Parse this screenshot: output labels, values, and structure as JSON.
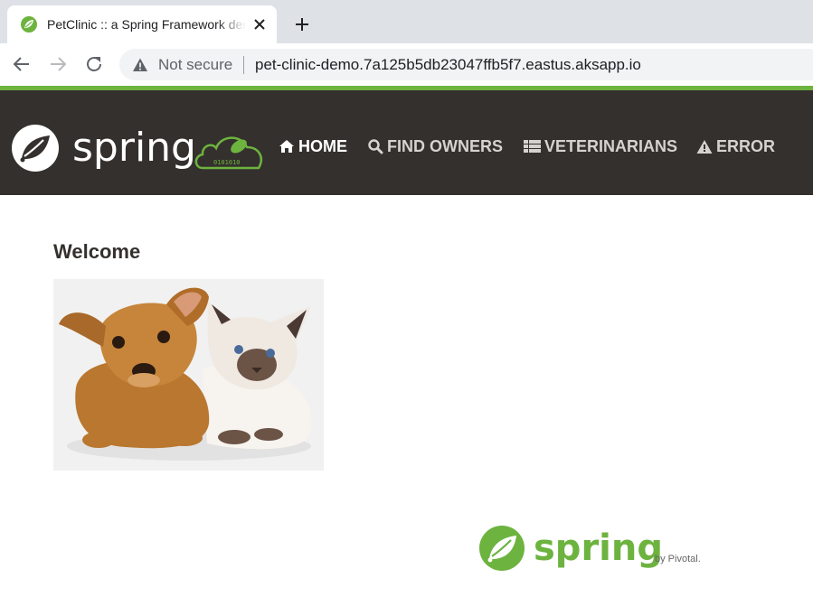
{
  "browser": {
    "tab": {
      "title": "PetClinic :: a Spring Framework demonstration",
      "favicon": "spring-leaf-icon",
      "close_icon": "close-icon"
    },
    "new_tab_icon": "plus-icon",
    "nav": {
      "back_icon": "arrow-left-icon",
      "forward_icon": "arrow-right-icon",
      "reload_icon": "reload-icon"
    },
    "omnibox": {
      "security_icon": "warning-triangle-icon",
      "security_label": "Not secure",
      "url": "pet-clinic-demo.7a125b5db23047ffb5f7.eastus.aksapp.io"
    }
  },
  "navbar": {
    "brand_logo": "spring-logo",
    "items": [
      {
        "label": "HOME",
        "icon": "home-icon",
        "active": true
      },
      {
        "label": "FIND OWNERS",
        "icon": "search-icon",
        "active": false
      },
      {
        "label": "VETERINARIANS",
        "icon": "list-icon",
        "active": false
      },
      {
        "label": "ERROR",
        "icon": "warning-icon",
        "active": false
      }
    ]
  },
  "main": {
    "heading": "Welcome",
    "image": "pets-photo"
  },
  "footer": {
    "logo": "spring-by-pivotal-logo",
    "logo_text": "spring",
    "byline": "by Pivotal."
  },
  "colors": {
    "spring_green": "#6db33f",
    "navbar_bg": "#34302d",
    "nav_text": "#d6d2cf",
    "tabstrip_bg": "#dee1e6"
  }
}
